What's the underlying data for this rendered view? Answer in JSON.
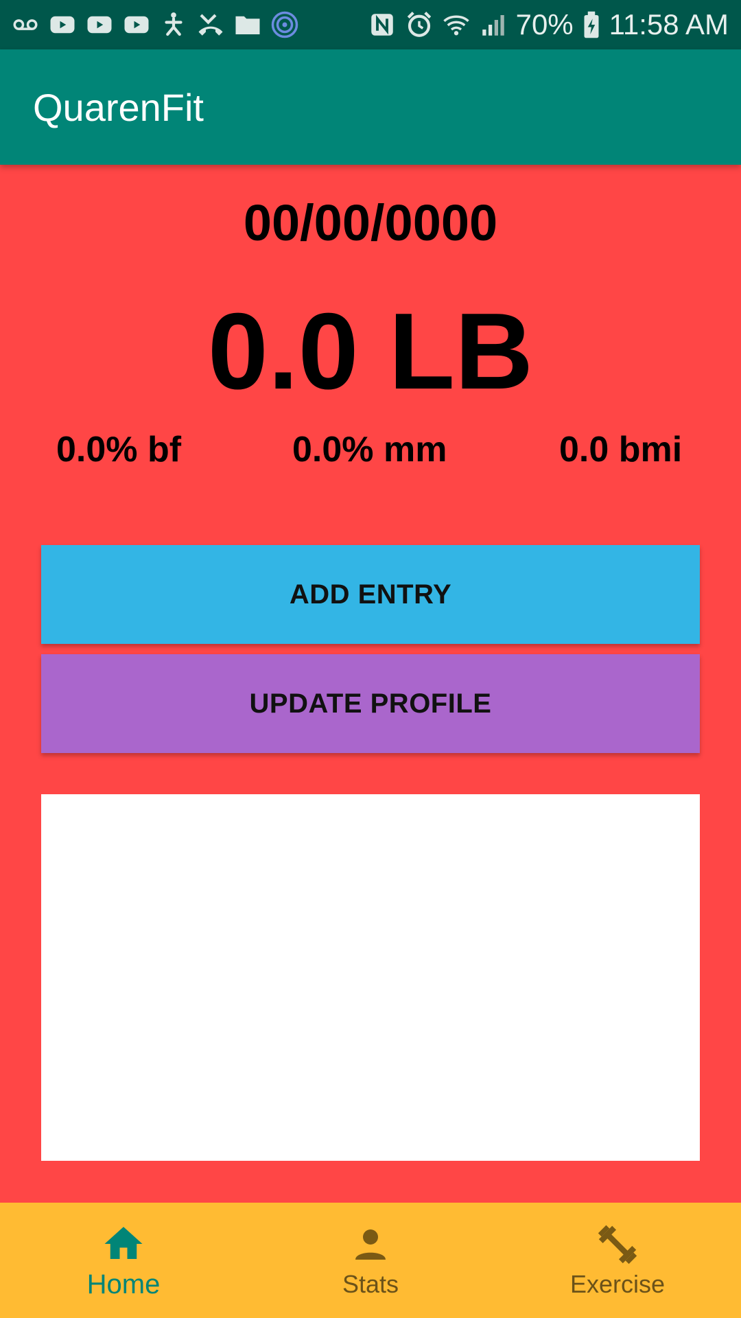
{
  "status_bar": {
    "left_icons": [
      "voicemail-icon",
      "youtube-icon",
      "youtube-icon",
      "youtube-icon",
      "accessibility-icon",
      "missed-call-icon",
      "folder-icon",
      "app-notification-icon"
    ],
    "right_icons": [
      "nfc-icon",
      "alarm-icon",
      "wifi-icon",
      "signal-icon"
    ],
    "battery_percent": "70%",
    "time": "11:58 AM"
  },
  "app_bar": {
    "title": "QuarenFit"
  },
  "summary": {
    "date": "00/00/0000",
    "weight": "0.0 LB",
    "body_fat": "0.0% bf",
    "muscle_mass": "0.0% mm",
    "bmi": "0.0 bmi"
  },
  "actions": {
    "add_entry_label": "ADD ENTRY",
    "update_profile_label": "UPDATE PROFILE"
  },
  "bottom_nav": {
    "items": [
      {
        "label": "Home",
        "icon": "home-icon",
        "active": true
      },
      {
        "label": "Stats",
        "icon": "person-icon",
        "active": false
      },
      {
        "label": "Exercise",
        "icon": "dumbbell-icon",
        "active": false
      }
    ]
  },
  "colors": {
    "status_bar": "#00574B",
    "app_bar": "#018577",
    "background": "#FF4646",
    "add_entry": "#33B5E5",
    "update_profile": "#AA66CC",
    "bottom_nav": "#FFBB33",
    "active_nav": "#018577"
  }
}
